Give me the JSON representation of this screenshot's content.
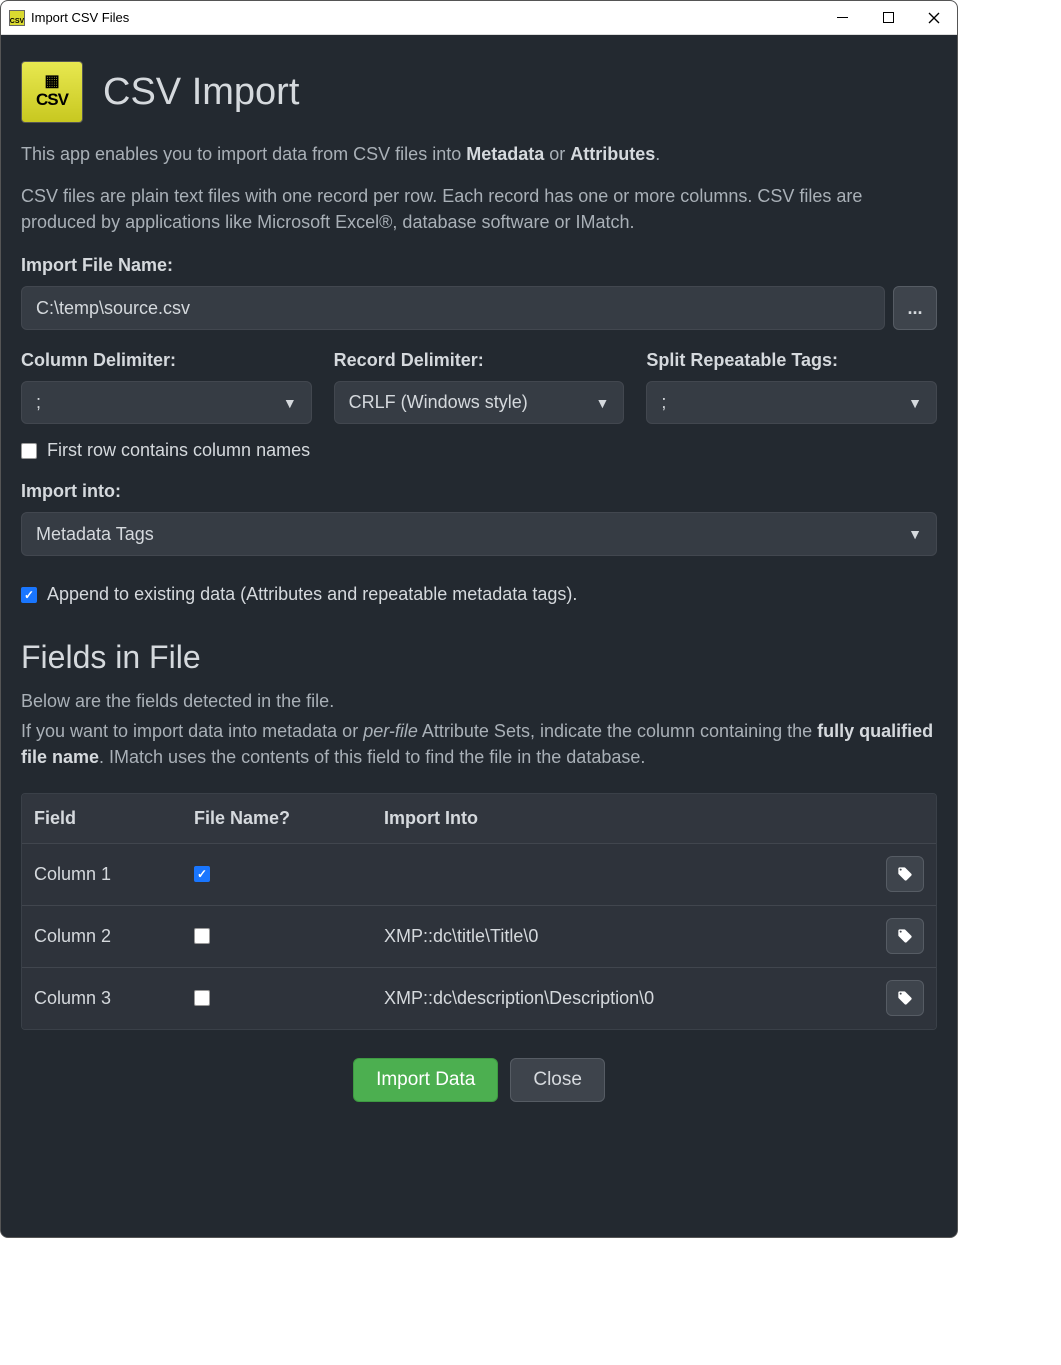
{
  "window": {
    "title": "Import CSV Files"
  },
  "header": {
    "title": "CSV Import"
  },
  "intro": {
    "line1_pre": "This app enables you to import data from CSV files into ",
    "line1_b1": "Metadata",
    "line1_mid": " or ",
    "line1_b2": "Attributes",
    "line1_post": ".",
    "line2": "CSV files are plain text files with one record per row. Each record has one or more columns. CSV files are produced by applications like Microsoft Excel®, database software or IMatch."
  },
  "form": {
    "file_label": "Import File Name:",
    "file_value": "C:\\temp\\source.csv",
    "browse_label": "...",
    "col_delim_label": "Column Delimiter:",
    "col_delim_value": ";",
    "rec_delim_label": "Record Delimiter:",
    "rec_delim_value": "CRLF (Windows style)",
    "split_label": "Split Repeatable Tags:",
    "split_value": ";",
    "first_row_label": "First row contains column names",
    "first_row_checked": false,
    "import_into_label": "Import into:",
    "import_into_value": "Metadata Tags",
    "append_label": "Append to existing data (Attributes and repeatable metadata tags).",
    "append_checked": true
  },
  "fields_section": {
    "title": "Fields in File",
    "desc_l1": "Below are the fields detected in the file.",
    "desc_l2_pre": "If you want to import data into metadata or ",
    "desc_l2_i": "per-file",
    "desc_l2_mid": " Attribute Sets, indicate the column containing the ",
    "desc_l2_b": "fully qualified file name",
    "desc_l2_post": ". IMatch uses the contents of this field to find the file in the database.",
    "headers": {
      "field": "Field",
      "filename": "File Name?",
      "into": "Import Into"
    },
    "rows": [
      {
        "field": "Column 1",
        "filename_checked": true,
        "into": ""
      },
      {
        "field": "Column 2",
        "filename_checked": false,
        "into": "XMP::dc\\title\\Title\\0"
      },
      {
        "field": "Column 3",
        "filename_checked": false,
        "into": "XMP::dc\\description\\Description\\0"
      }
    ]
  },
  "footer": {
    "import": "Import Data",
    "close": "Close"
  }
}
